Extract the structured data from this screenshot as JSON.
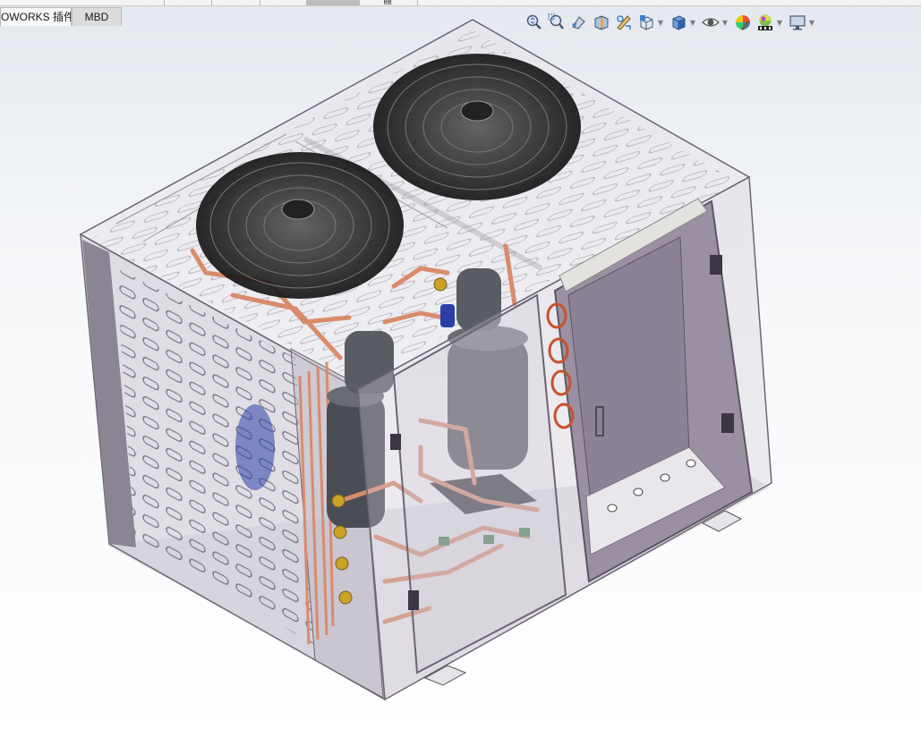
{
  "top_strip": {
    "label": "體"
  },
  "tabs": [
    {
      "label": "OWORKS 插件"
    },
    {
      "label": "MBD"
    }
  ],
  "toolbar": {
    "buttons": [
      {
        "icon": "zoom-to-fit-icon"
      },
      {
        "icon": "zoom-to-area-icon"
      },
      {
        "icon": "previous-view-icon"
      },
      {
        "icon": "section-view-icon"
      },
      {
        "icon": "dynamic-annotation-views-icon"
      },
      {
        "icon": "view-orientation-icon",
        "has_dropdown": true
      },
      {
        "icon": "display-style-icon",
        "has_dropdown": true
      },
      {
        "icon": "hide-show-items-icon",
        "has_dropdown": true
      },
      {
        "icon": "edit-appearance-icon"
      },
      {
        "icon": "apply-scene-icon",
        "has_dropdown": true
      },
      {
        "icon": "view-settings-icon",
        "has_dropdown": true
      }
    ]
  },
  "model": {
    "description_colors": {
      "cabinet_frame": "#8b8492",
      "side_panel": "#b9b3bf",
      "door_panel": "#9a90a2",
      "copper_pipe": "#d98b6b",
      "fan_guard": "#1a1a1a",
      "compressor": "#4b4d55",
      "brass_valve": "#c9a227",
      "drier": "#2a3fa8"
    }
  }
}
